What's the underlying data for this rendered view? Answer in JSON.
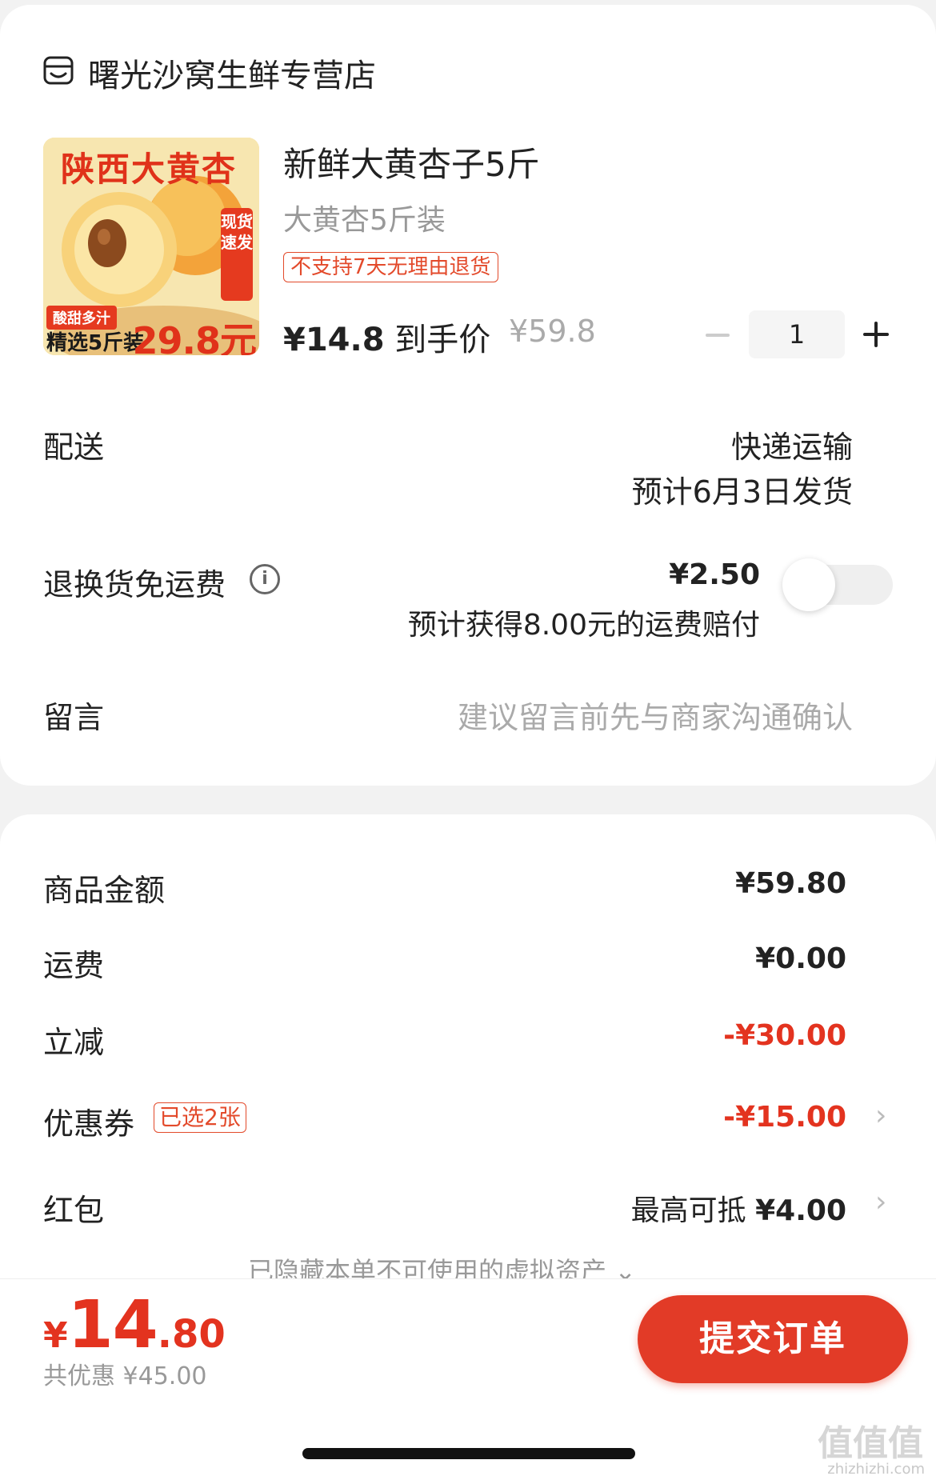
{
  "shop": {
    "name": "曙光沙窝生鲜专营店",
    "icon": "store-icon"
  },
  "product": {
    "image": {
      "title": "陕西大黄杏",
      "vertical_tag": "现货速发",
      "small_tag": "酸甜多汁",
      "bottom_text": "精选5斤装",
      "price": "29.8元"
    },
    "title": "新鲜大黄杏子5斤",
    "spec": "大黄杏5斤装",
    "tag": "不支持7天无理由退货",
    "price_now": "¥14.8",
    "price_now_suffix": "到手价",
    "price_original": "¥59.8",
    "quantity": "1"
  },
  "delivery": {
    "label": "配送",
    "method": "快递运输",
    "eta": "预计6月3日发货"
  },
  "return_insurance": {
    "label": "退换货免运费",
    "price": "¥2.50",
    "desc": "预计获得8.00元的运费赔付",
    "enabled": false
  },
  "message": {
    "label": "留言",
    "placeholder": "建议留言前先与商家沟通确认"
  },
  "summary": {
    "goods_label": "商品金额",
    "goods_value": "¥59.80",
    "shipping_label": "运费",
    "shipping_value": "¥0.00",
    "discount_label": "立减",
    "discount_value": "-¥30.00",
    "coupon_label": "优惠券",
    "coupon_tag": "已选2张",
    "coupon_value": "-¥15.00",
    "redpack_label": "红包",
    "redpack_prefix": "最高可抵",
    "redpack_value": "¥4.00",
    "hidden_assets": "已隐藏本单不可使用的虚拟资产"
  },
  "footer": {
    "currency": "¥",
    "total_int": "14",
    "total_dec": ".80",
    "saved": "共优惠 ¥45.00",
    "submit_label": "提交订单"
  },
  "watermark": {
    "main": "值值值",
    "sub": "zhizhizhi.com"
  },
  "colors": {
    "accent": "#e3331f",
    "button": "#e23b27"
  }
}
